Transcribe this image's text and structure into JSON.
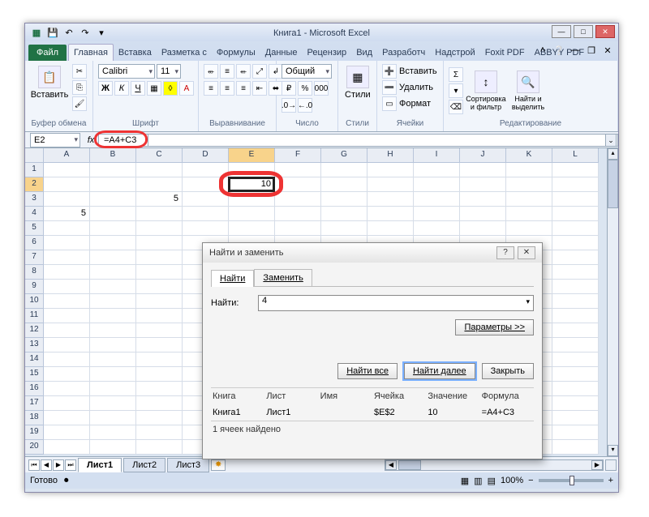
{
  "title": {
    "book": "Книга1",
    "sep": " - ",
    "app": "Microsoft Excel"
  },
  "qat": {
    "save": "save-icon",
    "undo": "undo",
    "redo": "redo"
  },
  "tabs": {
    "file": "Файл",
    "items": [
      "Главная",
      "Вставка",
      "Разметка с",
      "Формулы",
      "Данные",
      "Рецензир",
      "Вид",
      "Разработч",
      "Надстрой",
      "Foxit PDF",
      "ABBYY PDF"
    ]
  },
  "ribbon": {
    "clipboard": {
      "paste": "Вставить",
      "title": "Буфер обмена"
    },
    "font": {
      "name": "Calibri",
      "size": "11",
      "title": "Шрифт"
    },
    "align": {
      "title": "Выравнивание"
    },
    "number": {
      "format": "Общий",
      "title": "Число"
    },
    "styles": {
      "btn": "Стили",
      "title": "Стили"
    },
    "cells": {
      "insert": "Вставить",
      "delete": "Удалить",
      "format": "Формат",
      "title": "Ячейки"
    },
    "editing": {
      "sort": "Сортировка и фильтр",
      "find": "Найти и выделить",
      "title": "Редактирование"
    }
  },
  "namebox": "E2",
  "formula": "=A4+C3",
  "columns": [
    "A",
    "B",
    "C",
    "D",
    "E",
    "F",
    "G",
    "H",
    "I",
    "J",
    "K",
    "L"
  ],
  "rows": [
    "1",
    "2",
    "3",
    "4",
    "5",
    "6",
    "7",
    "8",
    "9",
    "10",
    "11",
    "12",
    "13",
    "14",
    "15",
    "16",
    "17",
    "18",
    "19",
    "20"
  ],
  "cellvals": {
    "C3": "5",
    "A4": "5",
    "E2": "10"
  },
  "dialog": {
    "title": "Найти и заменить",
    "tab_find": "Найти",
    "tab_replace": "Заменить",
    "label_find": "Найти:",
    "value": "4",
    "params": "Параметры >>",
    "btn_all": "Найти все",
    "btn_next": "Найти далее",
    "btn_close": "Закрыть",
    "cols": {
      "book": "Книга",
      "sheet": "Лист",
      "name": "Имя",
      "cell": "Ячейка",
      "value": "Значение",
      "formula": "Формула"
    },
    "row": {
      "book": "Книга1",
      "sheet": "Лист1",
      "name": "",
      "cell": "$E$2",
      "value": "10",
      "formula": "=A4+C3"
    },
    "found": "1 ячеек найдено"
  },
  "wsheets": {
    "s1": "Лист1",
    "s2": "Лист2",
    "s3": "Лист3"
  },
  "status": {
    "ready": "Готово",
    "zoom": "100%"
  }
}
